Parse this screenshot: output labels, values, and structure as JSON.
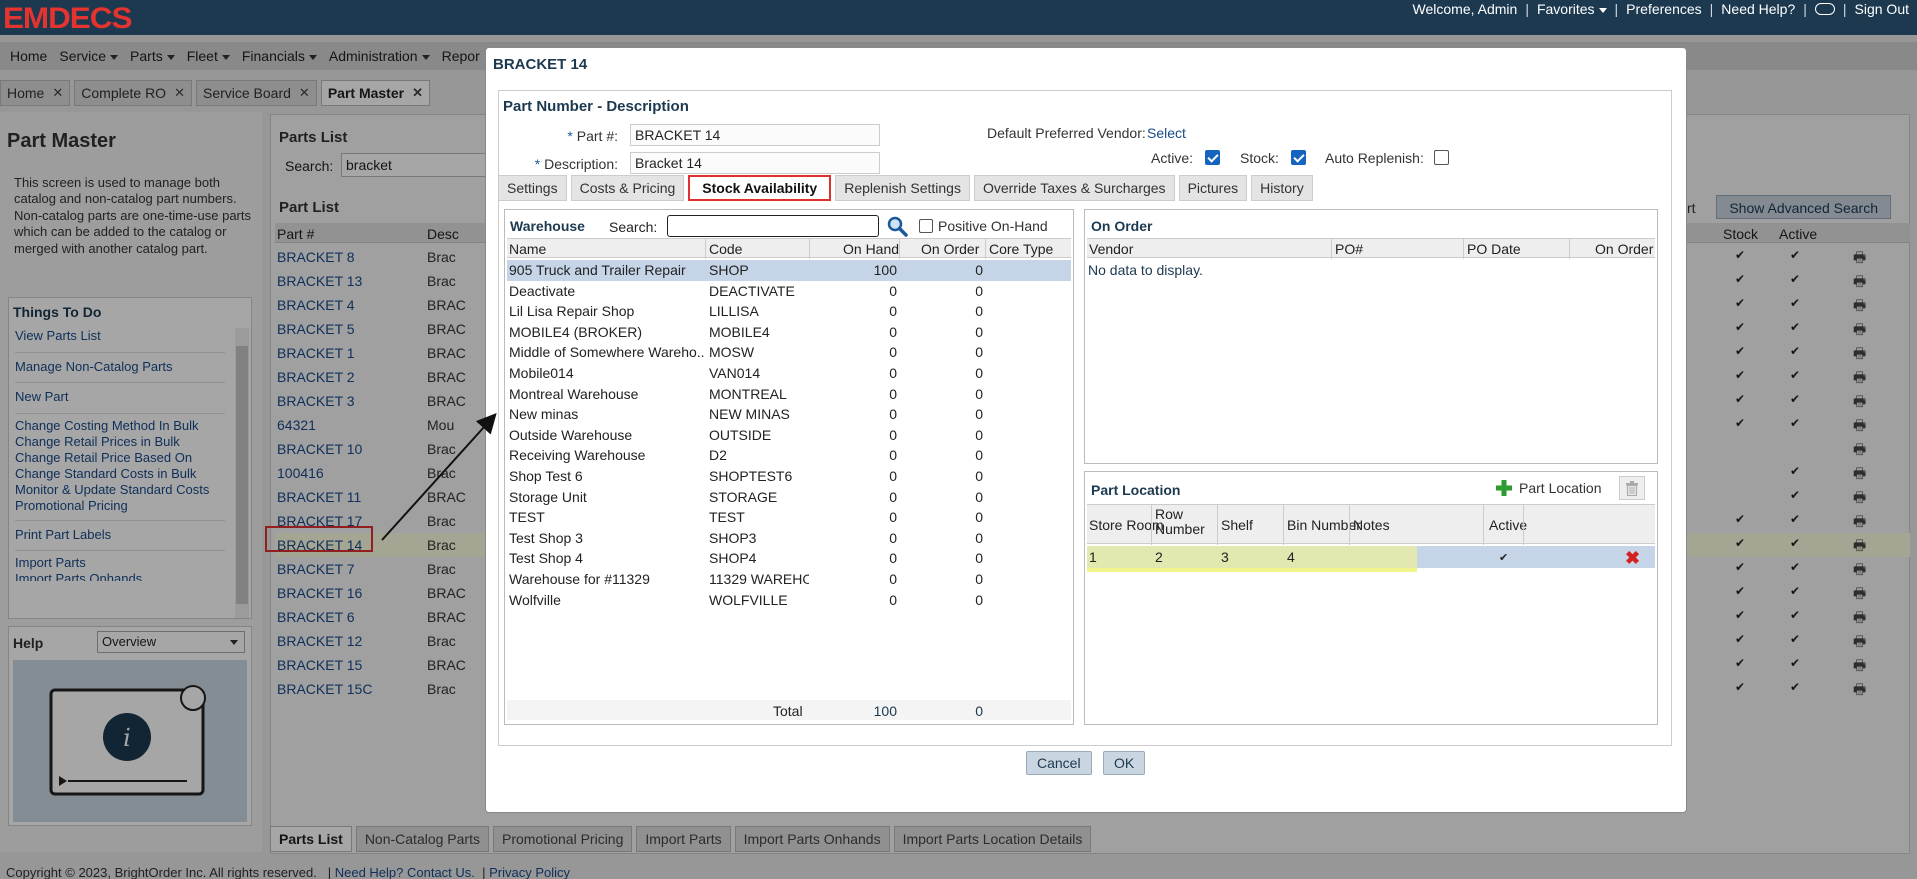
{
  "app": {
    "logo": "EMDECS"
  },
  "toplinks": {
    "welcome": "Welcome, Admin",
    "favorites": "Favorites",
    "preferences": "Preferences",
    "help": "Need Help?",
    "signout": "Sign Out"
  },
  "menu": [
    "Home",
    "Service",
    "Parts",
    "Fleet",
    "Financials",
    "Administration",
    "Repor"
  ],
  "page_tabs": [
    {
      "label": "Home"
    },
    {
      "label": "Complete RO"
    },
    {
      "label": "Service Board"
    },
    {
      "label": "Part Master"
    }
  ],
  "left": {
    "title": "Part Master",
    "description": "This screen is used to manage both catalog and non-catalog part numbers. Non-catalog parts are one-time-use parts which can be added to the catalog or merged with another catalog part.",
    "things_title": "Things To Do",
    "things": [
      "View Parts List",
      "Manage Non-Catalog Parts",
      "New Part",
      "Change Costing Method In Bulk",
      "Change Retail Prices in Bulk",
      "Change Retail Price Based On",
      "Change Standard Costs in Bulk",
      "Monitor & Update Standard Costs",
      "Promotional Pricing",
      "Print Part Labels",
      "Import Parts",
      "Import Parts Onhands"
    ],
    "help_title": "Help",
    "help_select": "Overview"
  },
  "parts_list": {
    "title": "Parts List",
    "search_label": "Search:",
    "search_value": "bracket",
    "subtitle": "Part List",
    "col_part": "Part #",
    "col_desc": "Desc",
    "col_stock": "Stock",
    "col_active": "Active",
    "adv_prefix": "rt",
    "adv_search": "Show Advanced Search",
    "rows": [
      {
        "part": "BRACKET 8",
        "desc": "Brac",
        "stock": "✔",
        "active": "✔"
      },
      {
        "part": "BRACKET 13",
        "desc": "Brac",
        "stock": "✔",
        "active": "✔"
      },
      {
        "part": "BRACKET 4",
        "desc": "BRAC",
        "stock": "✔",
        "active": "✔"
      },
      {
        "part": "BRACKET 5",
        "desc": "BRAC",
        "stock": "✔",
        "active": "✔"
      },
      {
        "part": "BRACKET 1",
        "desc": "BRAC",
        "stock": "✔",
        "active": "✔"
      },
      {
        "part": "BRACKET 2",
        "desc": "BRAC",
        "stock": "✔",
        "active": "✔"
      },
      {
        "part": "BRACKET 3",
        "desc": "BRAC",
        "stock": "✔",
        "active": "✔"
      },
      {
        "part": "64321",
        "desc": "Mou",
        "stock": "✔",
        "active": "✔"
      },
      {
        "part": "BRACKET 10",
        "desc": "Brac",
        "stock": "",
        "active": ""
      },
      {
        "part": "100416",
        "desc": "Brac",
        "stock": "",
        "active": "✔"
      },
      {
        "part": "BRACKET 11",
        "desc": "BRAC",
        "stock": "",
        "active": "✔"
      },
      {
        "part": "BRACKET 17",
        "desc": "Brac",
        "stock": "✔",
        "active": "✔"
      },
      {
        "part": "BRACKET 14",
        "desc": "Brac",
        "stock": "✔",
        "active": "✔"
      },
      {
        "part": "BRACKET 7",
        "desc": "Brac",
        "stock": "✔",
        "active": "✔"
      },
      {
        "part": "BRACKET 16",
        "desc": "BRAC",
        "stock": "✔",
        "active": "✔"
      },
      {
        "part": "BRACKET 6",
        "desc": "BRAC",
        "stock": "✔",
        "active": "✔"
      },
      {
        "part": "BRACKET 12",
        "desc": "Brac",
        "stock": "✔",
        "active": "✔"
      },
      {
        "part": "BRACKET 15",
        "desc": "BRAC",
        "stock": "✔",
        "active": "✔"
      },
      {
        "part": "BRACKET 15C",
        "desc": "Brac",
        "stock": "✔",
        "active": "✔"
      }
    ]
  },
  "bottom_tabs": [
    "Parts List",
    "Non-Catalog Parts",
    "Promotional Pricing",
    "Import Parts",
    "Import Parts Onhands",
    "Import Parts Location Details"
  ],
  "footer": {
    "copyright": "Copyright © 2023, BrightOrder Inc. All rights reserved.",
    "help": "Need Help? Contact Us.",
    "privacy": "Privacy Policy"
  },
  "dialog": {
    "title": "BRACKET 14",
    "section": "Part Number - Description",
    "part_label": "Part #:",
    "part_value": "BRACKET 14",
    "desc_label": "Description:",
    "desc_value": "Bracket 14",
    "vendor_label": "Default Preferred Vendor:",
    "vendor_link": "Select",
    "active_label": "Active:",
    "stock_label": "Stock:",
    "replenish_label": "Auto Replenish:",
    "active": true,
    "stock": true,
    "auto_replenish": false,
    "tabs": [
      "Settings",
      "Costs & Pricing",
      "Stock Availability",
      "Replenish Settings",
      "Override Taxes & Surcharges",
      "Pictures",
      "History"
    ],
    "warehouse": {
      "title": "Warehouse",
      "search_label": "Search:",
      "search_value": "",
      "positive_label": "Positive On-Hand",
      "cols": {
        "name": "Name",
        "code": "Code",
        "onhand": "On Hand",
        "onorder": "On Order",
        "core": "Core Type"
      },
      "rows": [
        {
          "name": "905 Truck and Trailer Repair",
          "code": "SHOP",
          "onhand": "100",
          "onorder": "0"
        },
        {
          "name": "Deactivate",
          "code": "DEACTIVATE",
          "onhand": "0",
          "onorder": "0"
        },
        {
          "name": "Lil Lisa Repair Shop",
          "code": "LILLISA",
          "onhand": "0",
          "onorder": "0"
        },
        {
          "name": "MOBILE4 (BROKER)",
          "code": "MOBILE4",
          "onhand": "0",
          "onorder": "0"
        },
        {
          "name": "Middle of Somewhere Wareho...",
          "code": "MOSW",
          "onhand": "0",
          "onorder": "0"
        },
        {
          "name": "Mobile014",
          "code": "VAN014",
          "onhand": "0",
          "onorder": "0"
        },
        {
          "name": "Montreal Warehouse",
          "code": "MONTREAL",
          "onhand": "0",
          "onorder": "0"
        },
        {
          "name": "New minas",
          "code": "NEW MINAS",
          "onhand": "0",
          "onorder": "0"
        },
        {
          "name": "Outside Warehouse",
          "code": "OUTSIDE",
          "onhand": "0",
          "onorder": "0"
        },
        {
          "name": "Receiving Warehouse",
          "code": "D2",
          "onhand": "0",
          "onorder": "0"
        },
        {
          "name": "Shop Test 6",
          "code": "SHOPTEST6",
          "onhand": "0",
          "onorder": "0"
        },
        {
          "name": "Storage Unit",
          "code": "STORAGE",
          "onhand": "0",
          "onorder": "0"
        },
        {
          "name": "TEST",
          "code": "TEST",
          "onhand": "0",
          "onorder": "0"
        },
        {
          "name": "Test Shop 3",
          "code": "SHOP3",
          "onhand": "0",
          "onorder": "0"
        },
        {
          "name": "Test Shop 4",
          "code": "SHOP4",
          "onhand": "0",
          "onorder": "0"
        },
        {
          "name": "Warehouse for #11329",
          "code": "11329 WAREHO",
          "onhand": "0",
          "onorder": "0"
        },
        {
          "name": "Wolfville",
          "code": "WOLFVILLE",
          "onhand": "0",
          "onorder": "0"
        }
      ],
      "total_label": "Total",
      "total_onhand": "100",
      "total_onorder": "0"
    },
    "on_order": {
      "title": "On Order",
      "cols": {
        "vendor": "Vendor",
        "po": "PO#",
        "date": "PO Date",
        "onorder": "On Order"
      },
      "empty": "No data to display."
    },
    "location": {
      "title": "Part Location",
      "add_label": "Part Location",
      "cols": {
        "store": "Store Room",
        "row": "Row Number",
        "shelf": "Shelf",
        "bin": "Bin Number",
        "notes": "Notes",
        "active": "Active"
      },
      "row": {
        "store": "1",
        "row": "2",
        "shelf": "3",
        "bin": "4",
        "notes": "",
        "active": "✔"
      }
    },
    "cancel": "Cancel",
    "ok": "OK"
  }
}
